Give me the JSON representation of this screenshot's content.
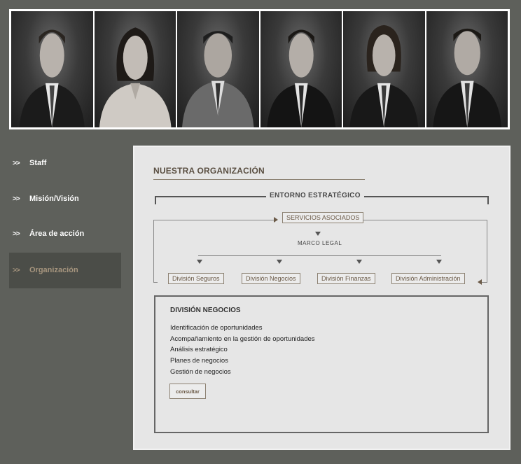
{
  "photos": [
    "person-1",
    "person-2",
    "person-3",
    "person-4",
    "person-5",
    "person-6"
  ],
  "nav": {
    "arrow": ">>",
    "items": [
      {
        "label": "Staff",
        "active": false
      },
      {
        "label": "Misión/Visión",
        "active": false
      },
      {
        "label": "Área de acción",
        "active": false
      },
      {
        "label": "Organización",
        "active": true
      }
    ]
  },
  "main": {
    "title": "NUESTRA ORGANIZACIÓN",
    "diagram": {
      "entorno": "ENTORNO ESTRATÉGICO",
      "servicios": "SERVICIOS ASOCIADOS",
      "marco": "MARCO LEGAL",
      "divisions": [
        "División Seguros",
        "División Negocios",
        "División Finanzas",
        "División Administración"
      ]
    },
    "detail": {
      "title": "DIVISIÓN NEGOCIOS",
      "items": [
        "Identificación de oportunidades",
        "Acompañamiento en la gestión de oportunidades",
        "Análisis estratégico",
        "Planes de negocios",
        "Gestión de negocios"
      ],
      "button": "consultar"
    }
  },
  "colors": {
    "background": "#5e605b",
    "panel": "#e6e6e6",
    "accent": "#a6957e",
    "active_nav_bg": "#4b4d48"
  }
}
